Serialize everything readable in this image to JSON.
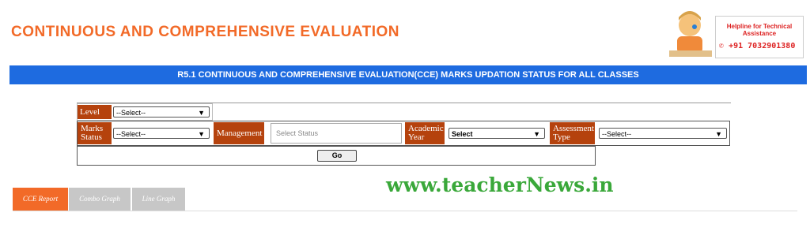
{
  "header": {
    "title": "CONTINUOUS AND COMPREHENSIVE EVALUATION",
    "helpline_title": "Helpline for Technical Assistance",
    "helpline_phone": "+91 7032901380"
  },
  "banner": {
    "text": "R5.1 CONTINUOUS AND COMPREHENSIVE EVALUATION(CCE) MARKS UPDATION STATUS FOR ALL CLASSES"
  },
  "form": {
    "level_label": "Level",
    "level_value": "--Select--",
    "marks_status_label": "Marks Status",
    "marks_status_value": "--Select--",
    "management_label": "Management",
    "management_placeholder": "Select Status",
    "academic_year_label": "Academic Year",
    "academic_year_value": "Select",
    "assessment_type_label": "Assessment Type",
    "assessment_type_value": "--Select--",
    "go_label": "Go"
  },
  "watermark": "www.teacherNews.in",
  "tabs": [
    {
      "label": "CCE Report",
      "active": true
    },
    {
      "label": "Combo Graph",
      "active": false
    },
    {
      "label": "Line Graph",
      "active": false
    }
  ],
  "colors": {
    "title": "#f26a28",
    "banner": "#1e6be0",
    "label_bg": "#b5420d",
    "active_tab": "#f26a28",
    "watermark": "#3aa83a"
  }
}
